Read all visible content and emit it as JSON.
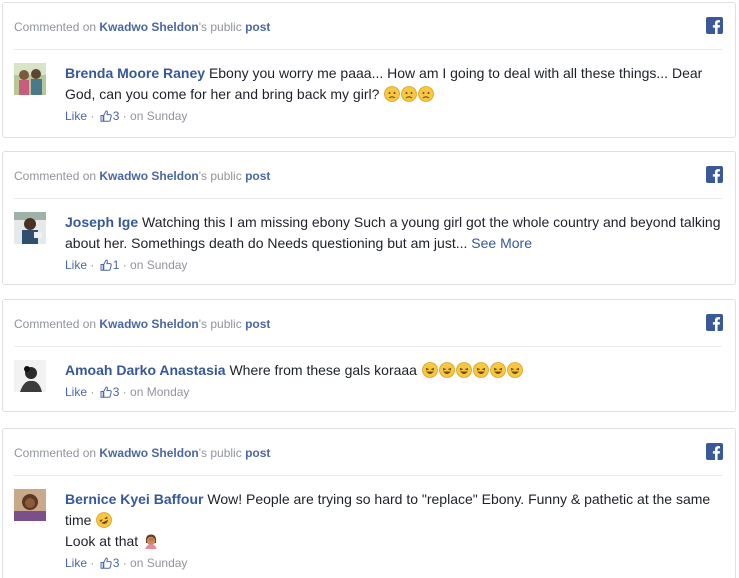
{
  "header": {
    "prefix": "Commented on",
    "owner": "Kwadwo Sheldon",
    "middle": "'s public",
    "post_link": "post"
  },
  "comments": [
    {
      "author": "Brenda Moore Raney",
      "text": "Ebony you worry me paaa... How am I going to deal with all these things... Dear God, can you come for her and bring back my girl?",
      "emojis": [
        "sad-face-icon",
        "sad-face-icon",
        "sad-face-icon"
      ],
      "like_label": "Like",
      "like_count": "3",
      "time": "on Sunday"
    },
    {
      "author": "Joseph Ige",
      "text": "Watching this I am missing ebony Such a young girl got the whole country and beyond talking about her. Somethings death do Needs questioning but am just...",
      "see_more": "See More",
      "like_label": "Like",
      "like_count": "1",
      "time": "on Sunday"
    },
    {
      "author": "Amoah Darko Anastasia",
      "text": "Where from these gals koraaa",
      "emojis": [
        "laughing-face-icon",
        "laughing-face-icon",
        "laughing-face-icon",
        "laughing-face-icon",
        "laughing-face-icon",
        "laughing-face-icon"
      ],
      "like_label": "Like",
      "like_count": "3",
      "time": "on Monday"
    },
    {
      "author": "Bernice Kyei Baffour",
      "text": "Wow! People are trying so hard to \"replace\" Ebony. Funny & pathetic at the same time",
      "emojis": [
        "rofl-face-icon"
      ],
      "line2": "Look at that",
      "line2_emojis": [
        "facepalm-woman-icon"
      ],
      "like_label": "Like",
      "like_count": "3",
      "time": "on Sunday"
    }
  ],
  "colors": {
    "link": "#365899",
    "meta": "#90949c",
    "facebook": "#3b5998",
    "border": "#dddfe2"
  }
}
